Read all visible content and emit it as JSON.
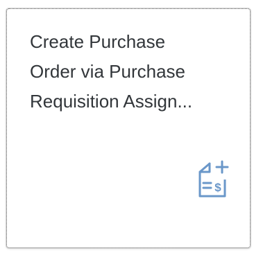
{
  "tile": {
    "title_lines": [
      "Create Purchase",
      "Order via Purchase",
      "Requisition Assign..."
    ],
    "icon": "create-purchase-document-icon",
    "icon_color": "#6a97c9"
  }
}
